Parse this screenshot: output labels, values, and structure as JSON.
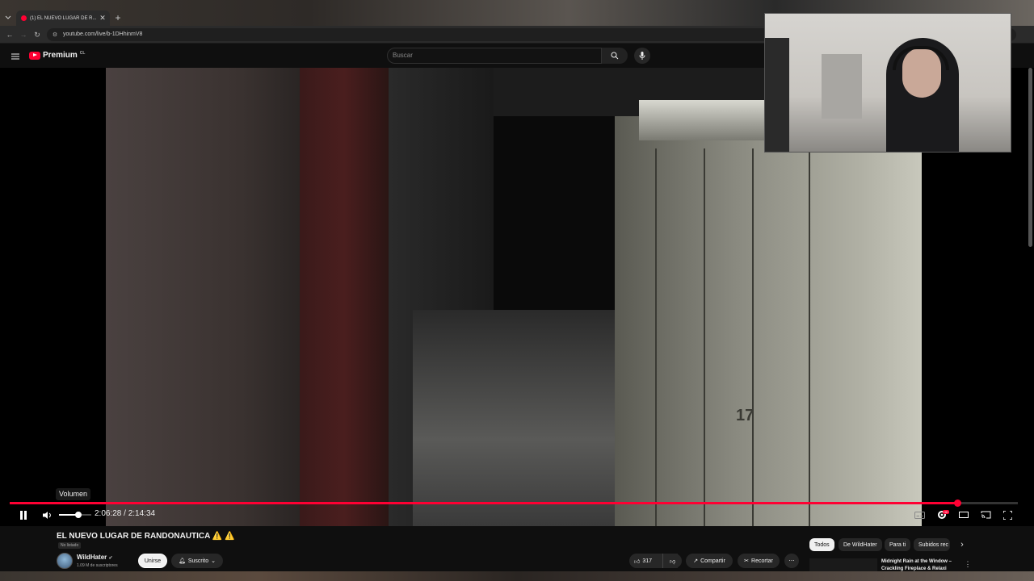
{
  "browser": {
    "tab_title": "(1) EL NUEVO LUGAR DE R...",
    "url": "youtube.com/live/b-1DHhinmV8"
  },
  "youtube": {
    "logo_text": "Premium",
    "logo_region": "CL",
    "search_placeholder": "Buscar"
  },
  "player": {
    "tooltip": "Volumen",
    "current_time": "2:06:28",
    "duration": "2:14:34",
    "time_display": "2:06:28 / 2:14:34",
    "progress_fraction": 0.94,
    "volume_fraction": 0.6,
    "locker_number": "17"
  },
  "video": {
    "title": "EL NUEVO LUGAR DE RANDONAUTICA",
    "title_emoji": "⚠️ ⚠️",
    "visibility": "No listado",
    "channel_name": "WildHater",
    "subscribers": "1.09 M de suscriptores",
    "join_label": "Unirse",
    "subscribed_label": "Suscrito",
    "likes": "317",
    "share_label": "Compartir",
    "clip_label": "Recortar"
  },
  "sidebar": {
    "chips": [
      "Todos",
      "De WildHater",
      "Para ti",
      "Subidos rec"
    ],
    "recommendation_title": "Midnight Rain at the Window – Crackling Fireplace & Relaxi"
  },
  "colors": {
    "accent": "#ff0033",
    "background": "#0f0f0f"
  }
}
